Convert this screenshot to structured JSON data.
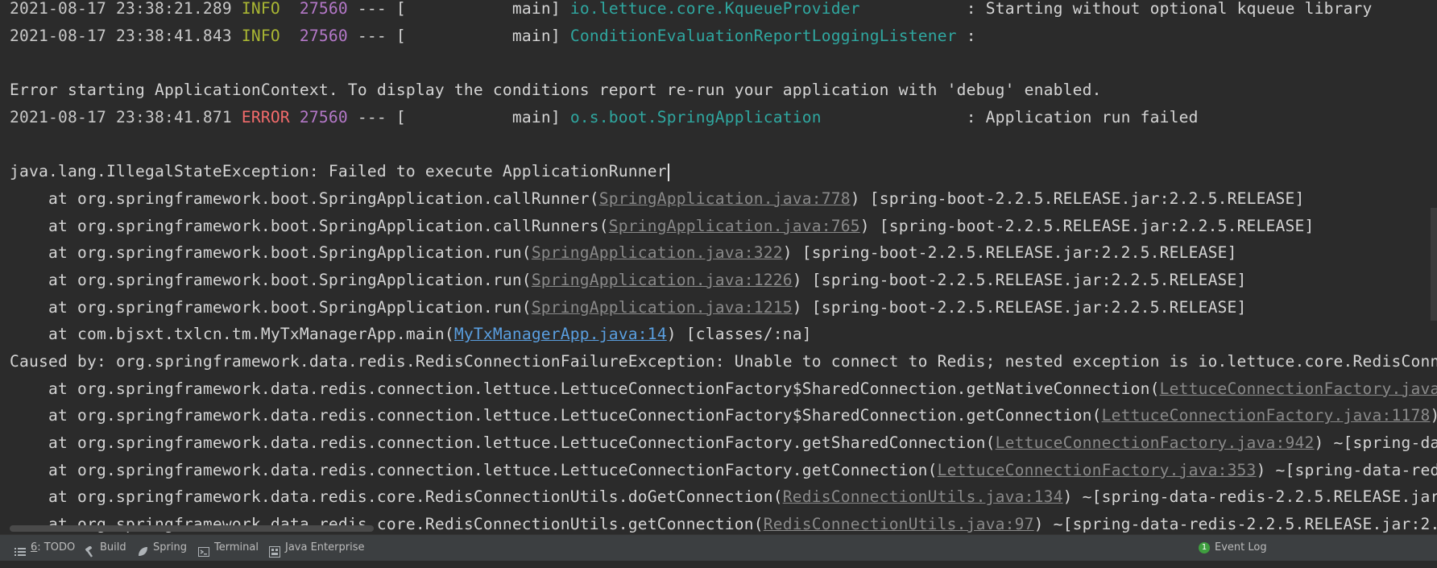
{
  "console": {
    "lines": [
      {
        "ts": "2021-08-17 23:38:21.289",
        "level": "INFO",
        "level_pad": "  ",
        "pid": "27560",
        "sep": " --- [           main] ",
        "logger": "io.lettuce.core.KqueueProvider",
        "logger_pad": "           ",
        "msg": ": Starting without optional kqueue library"
      },
      {
        "ts": "2021-08-17 23:38:41.843",
        "level": "INFO",
        "level_pad": "  ",
        "pid": "27560",
        "sep": " --- [           main] ",
        "logger": "ConditionEvaluationReportLoggingListener",
        "logger_pad": " ",
        "msg": ":"
      },
      {
        "text": ""
      },
      {
        "text": "Error starting ApplicationContext. To display the conditions report re-run your application with 'debug' enabled."
      },
      {
        "ts": "2021-08-17 23:38:41.871",
        "level": "ERROR",
        "level_pad": " ",
        "pid": "27560",
        "sep": " --- [           main] ",
        "logger": "o.s.boot.SpringApplication",
        "logger_pad": "               ",
        "msg": ": Application run failed"
      },
      {
        "text": ""
      },
      {
        "text": "java.lang.IllegalStateException: Failed to execute ApplicationRunner"
      },
      {
        "pre": "    at org.springframework.boot.SpringApplication.callRunner(",
        "link": "SpringApplication.java:778",
        "post": ") [spring-boot-2.2.5.RELEASE.jar:2.2.5.RELEASE]"
      },
      {
        "pre": "    at org.springframework.boot.SpringApplication.callRunners(",
        "link": "SpringApplication.java:765",
        "post": ") [spring-boot-2.2.5.RELEASE.jar:2.2.5.RELEASE]"
      },
      {
        "pre": "    at org.springframework.boot.SpringApplication.run(",
        "link": "SpringApplication.java:322",
        "post": ") [spring-boot-2.2.5.RELEASE.jar:2.2.5.RELEASE]"
      },
      {
        "pre": "    at org.springframework.boot.SpringApplication.run(",
        "link": "SpringApplication.java:1226",
        "post": ") [spring-boot-2.2.5.RELEASE.jar:2.2.5.RELEASE]"
      },
      {
        "pre": "    at org.springframework.boot.SpringApplication.run(",
        "link": "SpringApplication.java:1215",
        "post": ") [spring-boot-2.2.5.RELEASE.jar:2.2.5.RELEASE]"
      },
      {
        "pre": "    at com.bjsxt.txlcn.tm.MyTxManagerApp.main(",
        "link": "MyTxManagerApp.java:14",
        "post": ") [classes/:na]",
        "link_active": true
      },
      {
        "text": "Caused by: org.springframework.data.redis.RedisConnectionFailureException: Unable to connect to Redis; nested exception is io.lettuce.core.RedisConn"
      },
      {
        "pre": "    at org.springframework.data.redis.connection.lettuce.LettuceConnectionFactory$SharedConnection.getNativeConnection(",
        "link": "LettuceConnectionFactory.java",
        "post": ""
      },
      {
        "pre": "    at org.springframework.data.redis.connection.lettuce.LettuceConnectionFactory$SharedConnection.getConnection(",
        "link": "LettuceConnectionFactory.java:1178",
        "post": ")"
      },
      {
        "pre": "    at org.springframework.data.redis.connection.lettuce.LettuceConnectionFactory.getSharedConnection(",
        "link": "LettuceConnectionFactory.java:942",
        "post": ") ~[spring-da"
      },
      {
        "pre": "    at org.springframework.data.redis.connection.lettuce.LettuceConnectionFactory.getConnection(",
        "link": "LettuceConnectionFactory.java:353",
        "post": ") ~[spring-data-red"
      },
      {
        "pre": "    at org.springframework.data.redis.core.RedisConnectionUtils.doGetConnection(",
        "link": "RedisConnectionUtils.java:134",
        "post": ") ~[spring-data-redis-2.2.5.RELEASE.jar"
      },
      {
        "pre": "    at org.springframework.data.redis.core.RedisConnectionUtils.getConnection(",
        "link": "RedisConnectionUtils.java:97",
        "post": ") ~[spring-data-redis-2.2.5.RELEASE.jar:2."
      }
    ]
  },
  "toolbar": {
    "todo_prefix": "6",
    "todo_label": ": TODO",
    "build_label": "Build",
    "spring_label": "Spring",
    "terminal_label": "Terminal",
    "java_ee_label": "Java Enterprise",
    "event_log_badge": "1",
    "event_log_label": "Event Log"
  },
  "colors": {
    "background": "#2b2b2b",
    "info": "#a9b633",
    "error": "#f26b6b",
    "pid": "#b478c8",
    "logger": "#2fa7a0",
    "link_active": "#5a9fe0"
  }
}
